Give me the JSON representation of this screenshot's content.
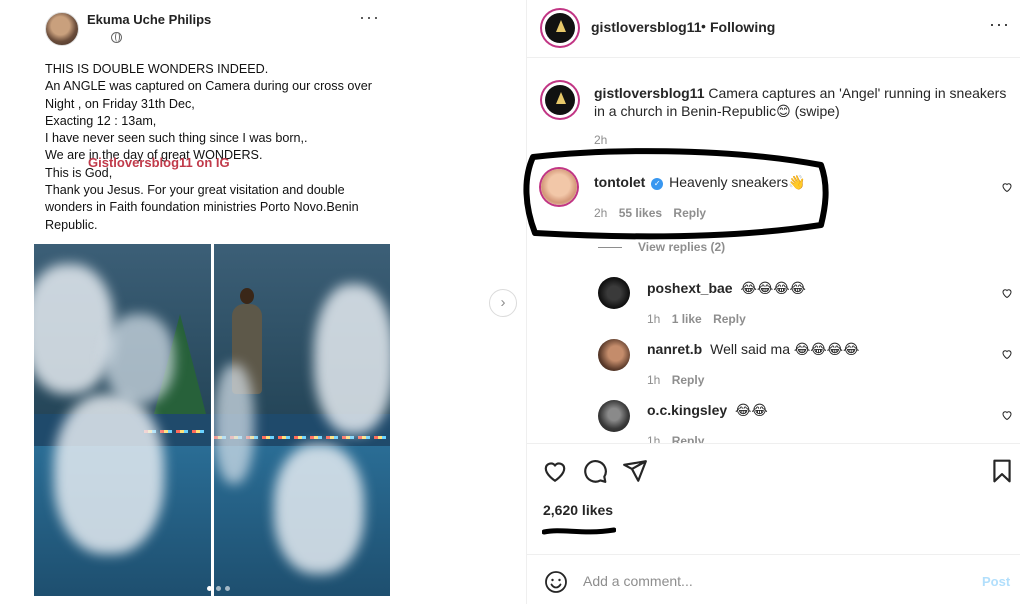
{
  "media": {
    "fb_author": "Ekuma Uche Philips",
    "fb_more": "···",
    "fb_text": "THIS IS DOUBLE WONDERS INDEED.\nAn ANGLE was captured on Camera during our cross over Night ,       on Friday 31th Dec,\nExacting 12 : 13am,\nI have never seen such thing since I was born,.\nWe are in the day of great WONDERS.\nThis is God,\nThank you Jesus. For your great visitation and double wonders in Faith foundation ministries Porto Novo.Benin Republic.",
    "watermark": "Gistloversblog11 on IG",
    "next_arrow": "›",
    "carousel_dots": 3,
    "carousel_active": 0
  },
  "header": {
    "username": "gistloversblog11",
    "separator": "•",
    "follow_state": "Following",
    "more": "···"
  },
  "caption": {
    "username": "gistloversblog11",
    "text": "Camera captures an 'Angel' running in sneakers in a church in Benin-Republic😊 (swipe)",
    "time": "2h"
  },
  "comments": [
    {
      "username": "tontolet",
      "verified": true,
      "text": "Heavenly sneakers👋",
      "time": "2h",
      "likes": "55 likes",
      "reply": "Reply"
    },
    {
      "username": "poshext_bae",
      "text": "😂😂😂😂",
      "time": "1h",
      "likes": "1 like",
      "reply": "Reply"
    },
    {
      "username": "nanret.b",
      "text": "Well said ma 😂😂😂😂",
      "time": "1h",
      "likes": "",
      "reply": "Reply"
    },
    {
      "username": "o.c.kingsley",
      "text": "😂😂",
      "time": "1h",
      "likes": "",
      "reply": "Reply"
    }
  ],
  "view_replies": "View replies (2)",
  "actions": {
    "likes_count": "2,620 likes"
  },
  "add_comment": {
    "placeholder": "Add a comment...",
    "post_label": "Post"
  },
  "colors": {
    "text": "#262626",
    "muted": "#8e8e8e",
    "border": "#efefef",
    "post_disabled": "#b2dffc",
    "verified": "#3897f0",
    "story_ring": "#c13584"
  },
  "icons": [
    "heart-icon",
    "comment-icon",
    "share-icon",
    "bookmark-icon",
    "emoji-icon",
    "more-icon",
    "verified-icon",
    "chevron-right-icon",
    "globe-icon"
  ]
}
